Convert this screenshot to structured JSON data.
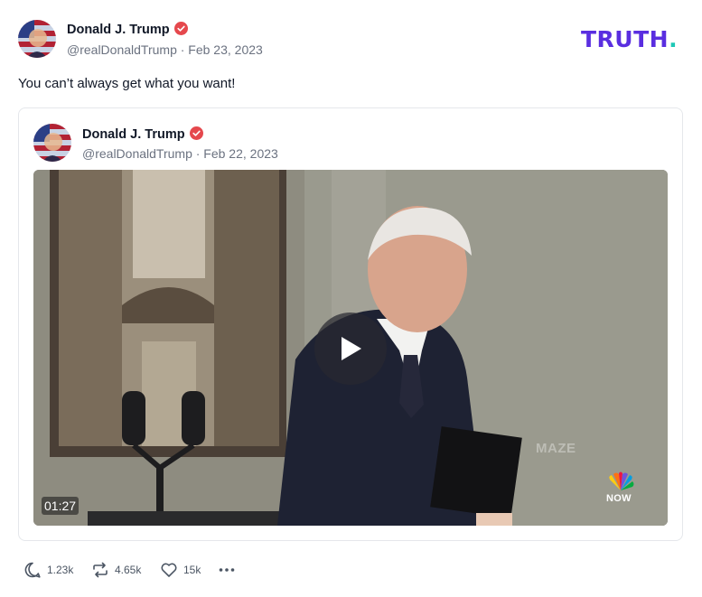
{
  "brand": {
    "logo_text": "TRUTH",
    "logo_dot": ".",
    "logo_color": "#5a2ee0",
    "dot_color": "#1ec8b6"
  },
  "post": {
    "author_name": "Donald J. Trump",
    "meta": "@realDonaldTrump · Feb 23, 2023",
    "text": "You can’t always get what you want!"
  },
  "quoted_post": {
    "author_name": "Donald J. Trump",
    "meta": "@realDonaldTrump · Feb 22, 2023",
    "video": {
      "duration": "01:27",
      "watermark": "MAZE",
      "network_badge": "NOW"
    }
  },
  "actions": {
    "replies": "1.23k",
    "retruths": "4.65k",
    "likes": "15k"
  },
  "colors": {
    "verified": "#e5484d",
    "muted_text": "#6b7280"
  }
}
